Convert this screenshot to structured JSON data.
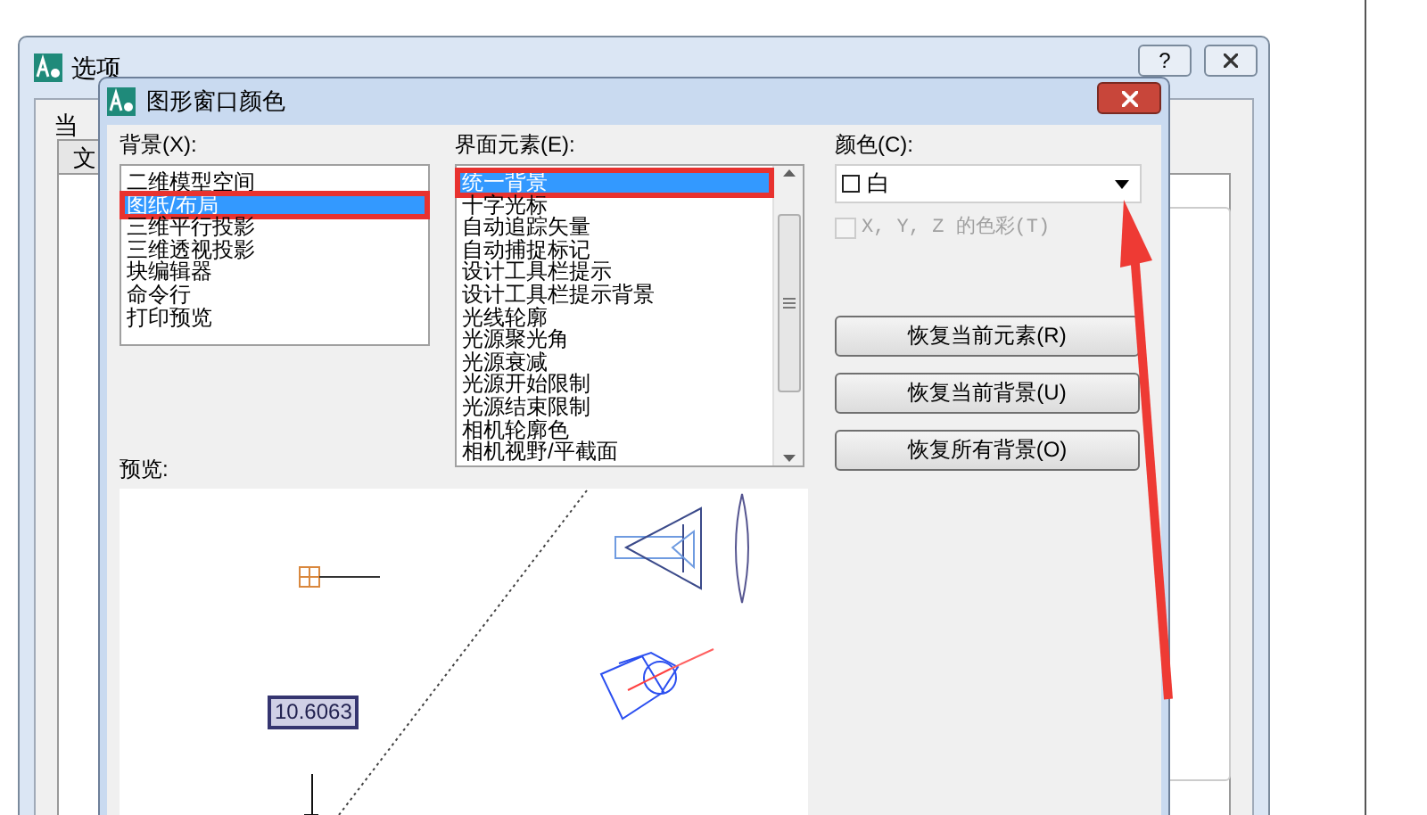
{
  "parent_window": {
    "title": "选项",
    "help": "?",
    "label_partial": "当",
    "tab_partial": "文"
  },
  "dialog": {
    "title": "图形窗口颜色"
  },
  "background": {
    "label": "背景(X):",
    "items": [
      {
        "label": "二维模型空间",
        "selected": false,
        "highlighted": false
      },
      {
        "label": "图纸/布局",
        "selected": true,
        "highlighted": true
      },
      {
        "label": "三维平行投影",
        "selected": false,
        "highlighted": false
      },
      {
        "label": "三维透视投影",
        "selected": false,
        "highlighted": false
      },
      {
        "label": "块编辑器",
        "selected": false,
        "highlighted": false
      },
      {
        "label": "命令行",
        "selected": false,
        "highlighted": false
      },
      {
        "label": "打印预览",
        "selected": false,
        "highlighted": false
      }
    ]
  },
  "elements": {
    "label": "界面元素(E):",
    "items": [
      {
        "label": "统一背景",
        "selected": true,
        "highlighted": true
      },
      {
        "label": "十字光标",
        "selected": false,
        "highlighted": false
      },
      {
        "label": "自动追踪矢量",
        "selected": false,
        "highlighted": false
      },
      {
        "label": "自动捕捉标记",
        "selected": false,
        "highlighted": false
      },
      {
        "label": "设计工具栏提示",
        "selected": false,
        "highlighted": false
      },
      {
        "label": "设计工具栏提示背景",
        "selected": false,
        "highlighted": false
      },
      {
        "label": "光线轮廓",
        "selected": false,
        "highlighted": false
      },
      {
        "label": "光源聚光角",
        "selected": false,
        "highlighted": false
      },
      {
        "label": "光源衰减",
        "selected": false,
        "highlighted": false
      },
      {
        "label": "光源开始限制",
        "selected": false,
        "highlighted": false
      },
      {
        "label": "光源结束限制",
        "selected": false,
        "highlighted": false
      },
      {
        "label": "相机轮廓色",
        "selected": false,
        "highlighted": false
      },
      {
        "label": "相机视野/平截面",
        "selected": false,
        "highlighted": false
      }
    ]
  },
  "color": {
    "label": "颜色(C):",
    "value": "白",
    "annotated": true
  },
  "xyz_checkbox": {
    "label": "X, Y, Z 的色彩(T)",
    "checked": false,
    "disabled": true
  },
  "buttons": [
    "恢复当前元素(R)",
    "恢复当前背景(U)",
    "恢复所有背景(O)"
  ],
  "preview": {
    "label": "预览:",
    "dimension": "10.6063"
  }
}
